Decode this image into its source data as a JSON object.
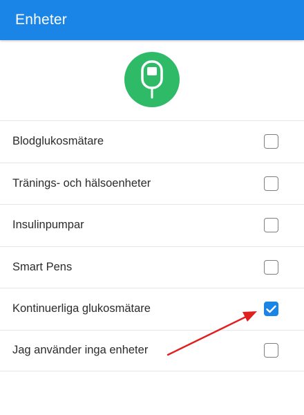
{
  "header": {
    "title": "Enheter",
    "color": "#1a85e6"
  },
  "device_icon": {
    "name": "glucose-meter-icon",
    "color": "#2fba68"
  },
  "devices": {
    "items": [
      {
        "label": "Blodglukosmätare",
        "checked": false
      },
      {
        "label": "Tränings- och hälsoenheter",
        "checked": false
      },
      {
        "label": "Insulinpumpar",
        "checked": false
      },
      {
        "label": "Smart Pens",
        "checked": false
      },
      {
        "label": "Kontinuerliga glukosmätare",
        "checked": true
      },
      {
        "label": "Jag använder inga enheter",
        "checked": false
      }
    ]
  },
  "annotation": {
    "arrow_color": "#e02020"
  }
}
